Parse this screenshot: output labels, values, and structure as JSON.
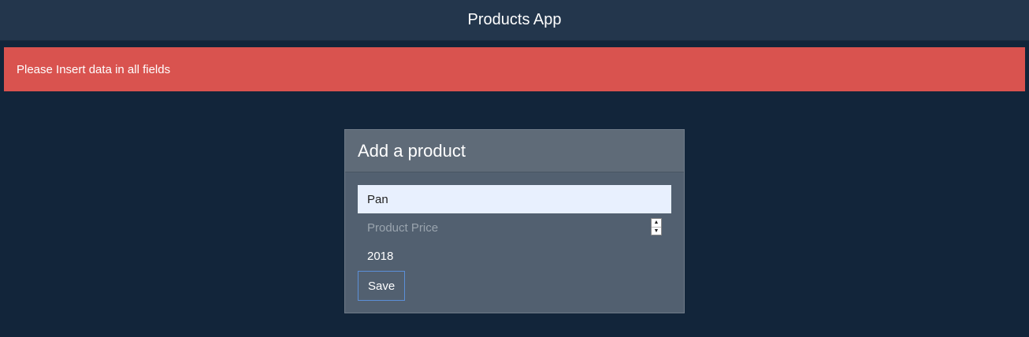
{
  "navbar": {
    "title": "Products App"
  },
  "alert": {
    "message": "Please Insert data in all fields",
    "color": "#d9534f"
  },
  "form": {
    "title": "Add a product",
    "name_value": "Pan",
    "price_value": "",
    "price_placeholder": "Product Price",
    "year_value": "2018",
    "save_label": "Save"
  }
}
